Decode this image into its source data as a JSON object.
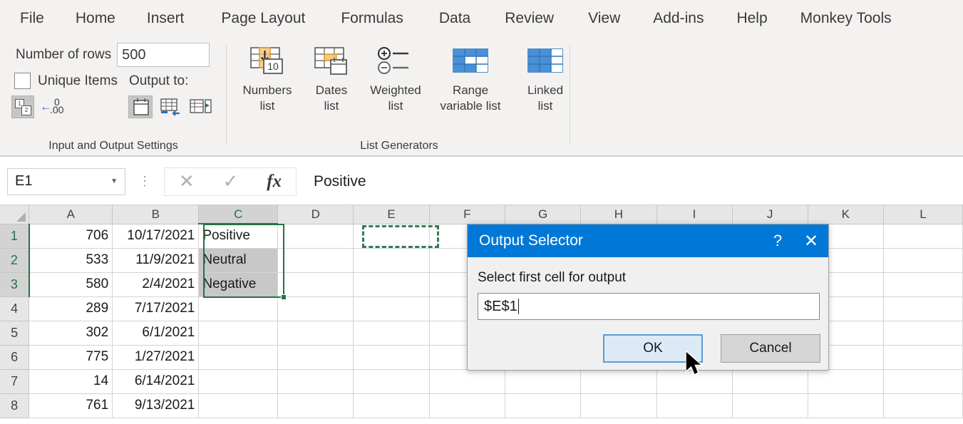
{
  "ribbon": {
    "tabs": [
      {
        "label": "File",
        "cls": "t-file"
      },
      {
        "label": "Home",
        "cls": "t-home"
      },
      {
        "label": "Insert",
        "cls": "t-insert"
      },
      {
        "label": "Page Layout",
        "cls": "t-page"
      },
      {
        "label": "Formulas",
        "cls": "t-formulas"
      },
      {
        "label": "Data",
        "cls": "t-data"
      },
      {
        "label": "Review",
        "cls": "t-review"
      },
      {
        "label": "View",
        "cls": "t-view"
      },
      {
        "label": "Add-ins",
        "cls": "t-addins"
      },
      {
        "label": "Help",
        "cls": "t-help"
      },
      {
        "label": "Monkey Tools",
        "cls": "t-monkey"
      }
    ],
    "group_io": {
      "label": "Input and Output Settings",
      "rows_label": "Number of rows",
      "rows_value": "500",
      "unique_label": "Unique Items",
      "unique_checked": false,
      "output_to_label": "Output to:",
      "decimal_zero": "0",
      "decimal_double": ".00"
    },
    "group_generators": {
      "label": "List Generators",
      "items": [
        {
          "line1": "Numbers",
          "line2": "list",
          "icon": "numbers-list-icon",
          "badge": "10"
        },
        {
          "line1": "Dates",
          "line2": "list",
          "icon": "dates-list-icon"
        },
        {
          "line1": "Weighted",
          "line2": "list",
          "icon": "weighted-list-icon"
        },
        {
          "line1": "Range",
          "line2": "variable list",
          "icon": "range-variable-list-icon"
        },
        {
          "line1": "Linked",
          "line2": "list",
          "icon": "linked-list-icon"
        }
      ]
    }
  },
  "formula_bar": {
    "name_box": "E1",
    "cancel_icon": "✕",
    "confirm_icon": "✓",
    "fx_icon": "fx",
    "formula_value": "Positive"
  },
  "grid": {
    "columns": [
      "A",
      "B",
      "C",
      "D",
      "E",
      "F",
      "G",
      "H",
      "I",
      "J",
      "K",
      "L"
    ],
    "selected_column": "C",
    "rows": [
      {
        "num": "1",
        "A": "706",
        "B": "10/17/2021",
        "C": "Positive",
        "D": "",
        "E": "",
        "F": "",
        "G": "",
        "H": "",
        "I": "",
        "J": "",
        "K": "",
        "L": ""
      },
      {
        "num": "2",
        "A": "533",
        "B": "11/9/2021",
        "C": "Neutral",
        "D": "",
        "E": "",
        "F": "",
        "G": "",
        "H": "",
        "I": "",
        "J": "",
        "K": "",
        "L": ""
      },
      {
        "num": "3",
        "A": "580",
        "B": "2/4/2021",
        "C": "Negative",
        "D": "",
        "E": "",
        "F": "",
        "G": "",
        "H": "",
        "I": "",
        "J": "",
        "K": "",
        "L": ""
      },
      {
        "num": "4",
        "A": "289",
        "B": "7/17/2021",
        "C": "",
        "D": "",
        "E": "",
        "F": "",
        "G": "",
        "H": "",
        "I": "",
        "J": "",
        "K": "",
        "L": ""
      },
      {
        "num": "5",
        "A": "302",
        "B": "6/1/2021",
        "C": "",
        "D": "",
        "E": "",
        "F": "",
        "G": "",
        "H": "",
        "I": "",
        "J": "",
        "K": "",
        "L": ""
      },
      {
        "num": "6",
        "A": "775",
        "B": "1/27/2021",
        "C": "",
        "D": "",
        "E": "",
        "F": "",
        "G": "",
        "H": "",
        "I": "",
        "J": "",
        "K": "",
        "L": ""
      },
      {
        "num": "7",
        "A": "14",
        "B": "6/14/2021",
        "C": "",
        "D": "",
        "E": "",
        "F": "",
        "G": "",
        "H": "",
        "I": "",
        "J": "",
        "K": "",
        "L": ""
      },
      {
        "num": "8",
        "A": "761",
        "B": "9/13/2021",
        "C": "",
        "D": "",
        "E": "",
        "F": "",
        "G": "",
        "H": "",
        "I": "",
        "J": "",
        "K": "",
        "L": ""
      }
    ]
  },
  "dialog": {
    "title": "Output Selector",
    "help_icon": "?",
    "close_icon": "✕",
    "prompt": "Select first cell for output",
    "input_value": "$E$1",
    "ok_label": "OK",
    "cancel_label": "Cancel"
  },
  "colors": {
    "dialog_title_bg": "#0078d7",
    "excel_green": "#217346",
    "ribbon_bg": "#f3f2f1",
    "accent_blue": "#5b9bd5"
  }
}
